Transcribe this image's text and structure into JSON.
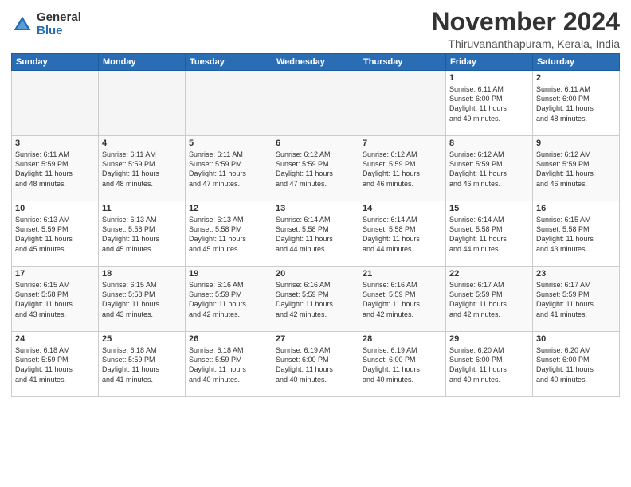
{
  "logo": {
    "general": "General",
    "blue": "Blue"
  },
  "title": "November 2024",
  "subtitle": "Thiruvananthapuram, Kerala, India",
  "headers": [
    "Sunday",
    "Monday",
    "Tuesday",
    "Wednesday",
    "Thursday",
    "Friday",
    "Saturday"
  ],
  "weeks": [
    [
      {
        "day": "",
        "info": ""
      },
      {
        "day": "",
        "info": ""
      },
      {
        "day": "",
        "info": ""
      },
      {
        "day": "",
        "info": ""
      },
      {
        "day": "",
        "info": ""
      },
      {
        "day": "1",
        "info": "Sunrise: 6:11 AM\nSunset: 6:00 PM\nDaylight: 11 hours\nand 49 minutes."
      },
      {
        "day": "2",
        "info": "Sunrise: 6:11 AM\nSunset: 6:00 PM\nDaylight: 11 hours\nand 48 minutes."
      }
    ],
    [
      {
        "day": "3",
        "info": "Sunrise: 6:11 AM\nSunset: 5:59 PM\nDaylight: 11 hours\nand 48 minutes."
      },
      {
        "day": "4",
        "info": "Sunrise: 6:11 AM\nSunset: 5:59 PM\nDaylight: 11 hours\nand 48 minutes."
      },
      {
        "day": "5",
        "info": "Sunrise: 6:11 AM\nSunset: 5:59 PM\nDaylight: 11 hours\nand 47 minutes."
      },
      {
        "day": "6",
        "info": "Sunrise: 6:12 AM\nSunset: 5:59 PM\nDaylight: 11 hours\nand 47 minutes."
      },
      {
        "day": "7",
        "info": "Sunrise: 6:12 AM\nSunset: 5:59 PM\nDaylight: 11 hours\nand 46 minutes."
      },
      {
        "day": "8",
        "info": "Sunrise: 6:12 AM\nSunset: 5:59 PM\nDaylight: 11 hours\nand 46 minutes."
      },
      {
        "day": "9",
        "info": "Sunrise: 6:12 AM\nSunset: 5:59 PM\nDaylight: 11 hours\nand 46 minutes."
      }
    ],
    [
      {
        "day": "10",
        "info": "Sunrise: 6:13 AM\nSunset: 5:59 PM\nDaylight: 11 hours\nand 45 minutes."
      },
      {
        "day": "11",
        "info": "Sunrise: 6:13 AM\nSunset: 5:58 PM\nDaylight: 11 hours\nand 45 minutes."
      },
      {
        "day": "12",
        "info": "Sunrise: 6:13 AM\nSunset: 5:58 PM\nDaylight: 11 hours\nand 45 minutes."
      },
      {
        "day": "13",
        "info": "Sunrise: 6:14 AM\nSunset: 5:58 PM\nDaylight: 11 hours\nand 44 minutes."
      },
      {
        "day": "14",
        "info": "Sunrise: 6:14 AM\nSunset: 5:58 PM\nDaylight: 11 hours\nand 44 minutes."
      },
      {
        "day": "15",
        "info": "Sunrise: 6:14 AM\nSunset: 5:58 PM\nDaylight: 11 hours\nand 44 minutes."
      },
      {
        "day": "16",
        "info": "Sunrise: 6:15 AM\nSunset: 5:58 PM\nDaylight: 11 hours\nand 43 minutes."
      }
    ],
    [
      {
        "day": "17",
        "info": "Sunrise: 6:15 AM\nSunset: 5:58 PM\nDaylight: 11 hours\nand 43 minutes."
      },
      {
        "day": "18",
        "info": "Sunrise: 6:15 AM\nSunset: 5:58 PM\nDaylight: 11 hours\nand 43 minutes."
      },
      {
        "day": "19",
        "info": "Sunrise: 6:16 AM\nSunset: 5:59 PM\nDaylight: 11 hours\nand 42 minutes."
      },
      {
        "day": "20",
        "info": "Sunrise: 6:16 AM\nSunset: 5:59 PM\nDaylight: 11 hours\nand 42 minutes."
      },
      {
        "day": "21",
        "info": "Sunrise: 6:16 AM\nSunset: 5:59 PM\nDaylight: 11 hours\nand 42 minutes."
      },
      {
        "day": "22",
        "info": "Sunrise: 6:17 AM\nSunset: 5:59 PM\nDaylight: 11 hours\nand 42 minutes."
      },
      {
        "day": "23",
        "info": "Sunrise: 6:17 AM\nSunset: 5:59 PM\nDaylight: 11 hours\nand 41 minutes."
      }
    ],
    [
      {
        "day": "24",
        "info": "Sunrise: 6:18 AM\nSunset: 5:59 PM\nDaylight: 11 hours\nand 41 minutes."
      },
      {
        "day": "25",
        "info": "Sunrise: 6:18 AM\nSunset: 5:59 PM\nDaylight: 11 hours\nand 41 minutes."
      },
      {
        "day": "26",
        "info": "Sunrise: 6:18 AM\nSunset: 5:59 PM\nDaylight: 11 hours\nand 40 minutes."
      },
      {
        "day": "27",
        "info": "Sunrise: 6:19 AM\nSunset: 6:00 PM\nDaylight: 11 hours\nand 40 minutes."
      },
      {
        "day": "28",
        "info": "Sunrise: 6:19 AM\nSunset: 6:00 PM\nDaylight: 11 hours\nand 40 minutes."
      },
      {
        "day": "29",
        "info": "Sunrise: 6:20 AM\nSunset: 6:00 PM\nDaylight: 11 hours\nand 40 minutes."
      },
      {
        "day": "30",
        "info": "Sunrise: 6:20 AM\nSunset: 6:00 PM\nDaylight: 11 hours\nand 40 minutes."
      }
    ]
  ]
}
